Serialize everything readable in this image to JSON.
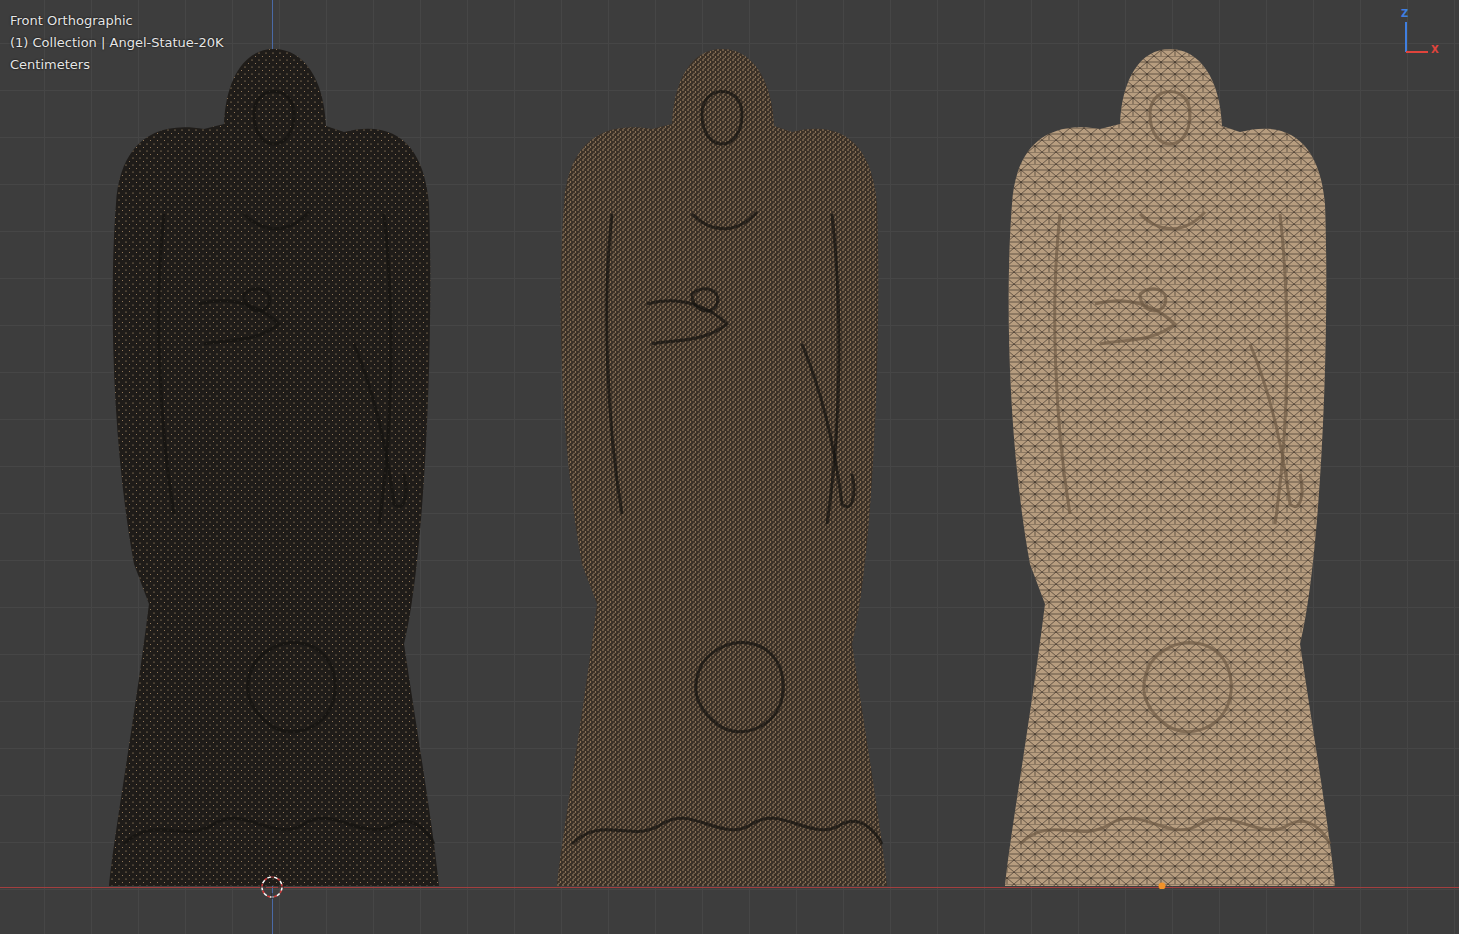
{
  "viewport": {
    "view": "Front Orthographic",
    "collection": "(1) Collection | Angel-Statue-20K",
    "units": "Centimeters"
  },
  "gizmo": {
    "axes": [
      {
        "label": "Z",
        "color": "#3f7fe0"
      },
      {
        "label": "X",
        "color": "#e0443c"
      }
    ]
  },
  "models": [
    {
      "kind": "points",
      "color": "#1f1c19",
      "selected": false
    },
    {
      "kind": "dense-points",
      "color": "#3a3027",
      "selected": false
    },
    {
      "kind": "wireframe",
      "color": "#b79d7f",
      "selected": true
    }
  ]
}
